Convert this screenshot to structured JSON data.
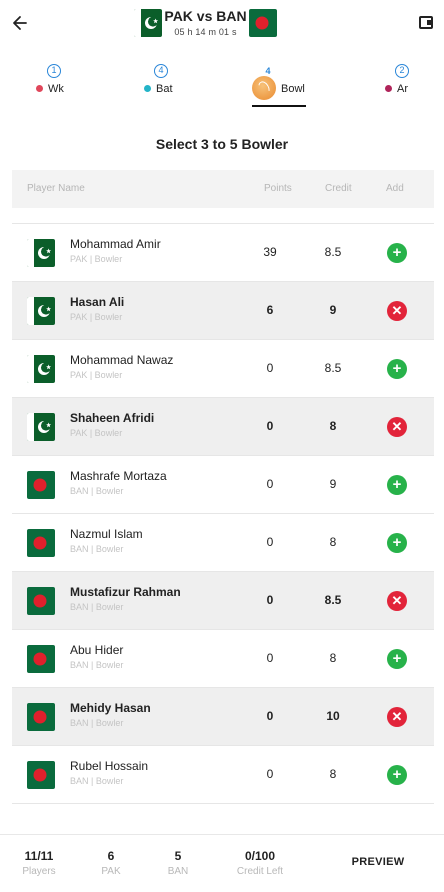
{
  "header": {
    "title": "PAK vs BAN",
    "timer": "05 h 14 m 01 s",
    "left_flag": "pakistan-flag",
    "right_flag": "bangladesh-flag"
  },
  "tabs": [
    {
      "key": "wk",
      "label": "Wk",
      "count": "1",
      "dot_color": "#e0475b"
    },
    {
      "key": "bat",
      "label": "Bat",
      "count": "4",
      "dot_color": "#23b4c8"
    },
    {
      "key": "bowl",
      "label": "Bowl",
      "count": "4",
      "active": true
    },
    {
      "key": "ar",
      "label": "Ar",
      "count": "2",
      "dot_color": "#b0245a"
    }
  ],
  "section_title": "Select 3 to 5 Bowler",
  "columns": {
    "name": "Player Name",
    "points": "Points",
    "credit": "Credit",
    "add": "Add"
  },
  "players": [
    {
      "name": "Mohammad Amir",
      "team_role": "PAK | Bowler",
      "team": "PAK",
      "points": "39",
      "credit": "8.5",
      "selected": false
    },
    {
      "name": "Hasan Ali",
      "team_role": "PAK | Bowler",
      "team": "PAK",
      "points": "6",
      "credit": "9",
      "selected": true
    },
    {
      "name": "Mohammad Nawaz",
      "team_role": "PAK | Bowler",
      "team": "PAK",
      "points": "0",
      "credit": "8.5",
      "selected": false
    },
    {
      "name": "Shaheen Afridi",
      "team_role": "PAK | Bowler",
      "team": "PAK",
      "points": "0",
      "credit": "8",
      "selected": true
    },
    {
      "name": "Mashrafe Mortaza",
      "team_role": "BAN | Bowler",
      "team": "BAN",
      "points": "0",
      "credit": "9",
      "selected": false
    },
    {
      "name": "Nazmul Islam",
      "team_role": "BAN | Bowler",
      "team": "BAN",
      "points": "0",
      "credit": "8",
      "selected": false
    },
    {
      "name": "Mustafizur Rahman",
      "team_role": "BAN | Bowler",
      "team": "BAN",
      "points": "0",
      "credit": "8.5",
      "selected": true
    },
    {
      "name": "Abu Hider",
      "team_role": "BAN | Bowler",
      "team": "BAN",
      "points": "0",
      "credit": "8",
      "selected": false
    },
    {
      "name": "Mehidy Hasan",
      "team_role": "BAN | Bowler",
      "team": "BAN",
      "points": "0",
      "credit": "10",
      "selected": true
    },
    {
      "name": "Rubel Hossain",
      "team_role": "BAN | Bowler",
      "team": "BAN",
      "points": "0",
      "credit": "8",
      "selected": false
    }
  ],
  "footer": {
    "players": {
      "value": "11/11",
      "label": "Players"
    },
    "pak": {
      "value": "6",
      "label": "PAK"
    },
    "ban": {
      "value": "5",
      "label": "BAN"
    },
    "credit_left": {
      "value": "0/100",
      "label": "Credit Left"
    },
    "preview_label": "PREVIEW"
  },
  "colors": {
    "add": "#27b24a",
    "remove": "#e2243a",
    "pak_green": "#0b5e2a",
    "ban_green": "#0a6b3d",
    "ban_red": "#e0202c",
    "tab_count": "#2a86d8"
  }
}
